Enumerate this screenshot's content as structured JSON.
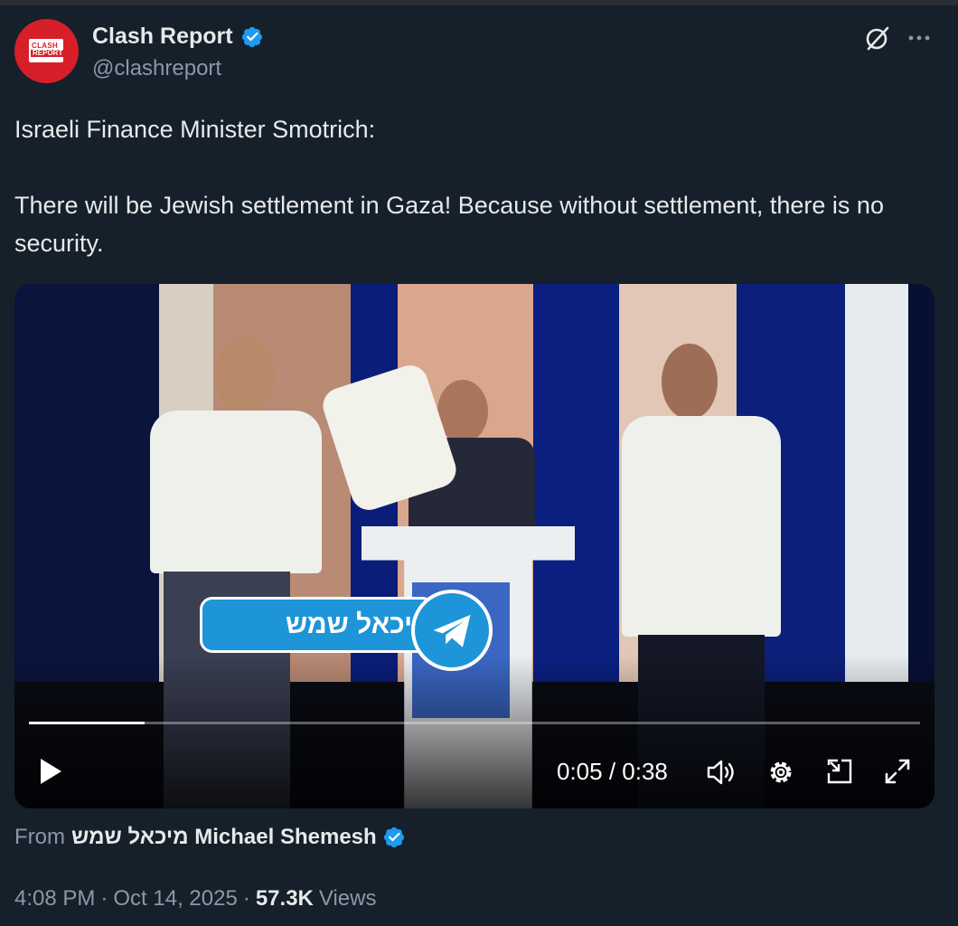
{
  "author": {
    "name": "Clash Report",
    "handle": "@clashreport",
    "avatar_text_line1": "CLASH",
    "avatar_text_line2": "REPORT"
  },
  "tweet": {
    "text": "Israeli Finance Minister Smotrich:\n\nThere will be Jewish settlement in Gaza! Because without settlement, there is no security."
  },
  "video": {
    "overlay_channel_name": "מיכאל שמש",
    "current_time": "0:05",
    "duration": "0:38",
    "time_display": "0:05 / 0:38",
    "progress_fraction": 0.13
  },
  "source": {
    "prefix": "From",
    "name": "מיכאל שמש Michael Shemesh"
  },
  "meta": {
    "time": "4:08 PM",
    "separator1": "·",
    "date": "Oct 14, 2025",
    "separator2": "·",
    "views_count": "57.3K",
    "views_label": "Views"
  },
  "icons": {
    "verified": "verified-badge-icon",
    "grok": "grok-icon",
    "more": "more-icon",
    "play": "play-icon",
    "volume": "volume-icon",
    "settings": "settings-gear-icon",
    "dock": "dock-icon",
    "fullscreen": "fullscreen-icon",
    "telegram": "telegram-icon"
  },
  "colors": {
    "background": "#15202b",
    "verified_blue": "#1d9bf0",
    "avatar_red": "#d71f2a",
    "telegram_blue": "#1e95d8",
    "secondary_text": "#8b98a5"
  }
}
